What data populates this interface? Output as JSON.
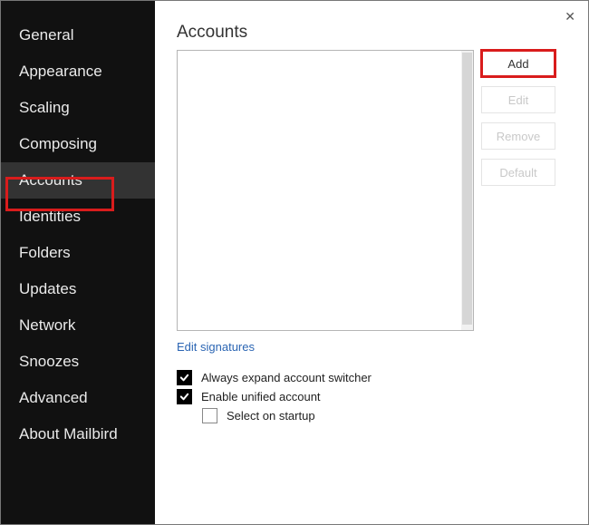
{
  "close_label": "✕",
  "sidebar": {
    "items": [
      {
        "label": "General"
      },
      {
        "label": "Appearance"
      },
      {
        "label": "Scaling"
      },
      {
        "label": "Composing"
      },
      {
        "label": "Accounts"
      },
      {
        "label": "Identities"
      },
      {
        "label": "Folders"
      },
      {
        "label": "Updates"
      },
      {
        "label": "Network"
      },
      {
        "label": "Snoozes"
      },
      {
        "label": "Advanced"
      },
      {
        "label": "About Mailbird"
      }
    ],
    "selected_index": 4
  },
  "main": {
    "title": "Accounts",
    "buttons": {
      "add": "Add",
      "edit": "Edit",
      "remove": "Remove",
      "default": "Default"
    },
    "edit_signatures": "Edit signatures",
    "checkboxes": {
      "always_expand": {
        "label": "Always expand account switcher",
        "checked": true
      },
      "enable_unified": {
        "label": "Enable unified account",
        "checked": true
      },
      "select_on_startup": {
        "label": "Select on startup",
        "checked": false
      }
    }
  }
}
